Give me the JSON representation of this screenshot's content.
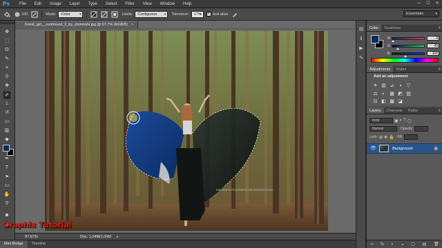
{
  "app": {
    "logo": "Ps"
  },
  "menu": {
    "items": [
      "File",
      "Edit",
      "Image",
      "Layer",
      "Type",
      "Select",
      "Filter",
      "View",
      "Window",
      "Help"
    ],
    "controls": [
      "—",
      "☐",
      "✕"
    ]
  },
  "options_bar": {
    "brush_size": "100",
    "mode_label": "Mode:",
    "mode_value": "Color",
    "limits_label": "Limits:",
    "limits_value": "Contiguous",
    "tolerance_label": "Tolerance:",
    "tolerance_value": "17%",
    "antialias_label": "Anti-alias",
    "workspace": "Essentials"
  },
  "document": {
    "tab_title": "forest_girl__continued_2_by_ztomoshi.jpg @ 97.7% (RGB/8)",
    "tab_close": "×",
    "zoom": "97.67%",
    "doc_size": "Doc: 1.04M/1.04M",
    "status_arrow": "▸",
    "image_caption": "BIELSKIPHOTOGRAPHY.DEVIANTART.COM"
  },
  "watermark": "Graphix Tutorial",
  "dock": {
    "tabs": [
      "Mini Bridge",
      "Timeline"
    ]
  },
  "color_panel": {
    "tabs": [
      "Color",
      "Swatches"
    ],
    "menu": "≡",
    "sliders": [
      {
        "letter": "R",
        "value": "4",
        "fraction": 0.016,
        "gradient": "linear-gradient(to right, #002a62, #ff2a62)"
      },
      {
        "letter": "G",
        "value": "43",
        "fraction": 0.169,
        "gradient": "linear-gradient(to right, #040062, #04ff62)"
      },
      {
        "letter": "B",
        "value": "106",
        "fraction": 0.416,
        "gradient": "linear-gradient(to right, #042a00, #042aff)"
      }
    ]
  },
  "adjustments": {
    "tabs": [
      "Adjustments",
      "Styles"
    ],
    "menu": "≡",
    "title": "Add an adjustment",
    "icons": [
      "☀",
      "▥",
      "⊿",
      "◑",
      "▽",
      "⚖",
      "◐",
      "▦",
      "◩",
      "▨",
      "⊟",
      "◧",
      "▩",
      "◪"
    ]
  },
  "layers": {
    "tabs": [
      "Layers",
      "Channels",
      "Paths"
    ],
    "menu": "≡",
    "filter_label": "Kind",
    "blend_mode": "Normal",
    "opacity_label": "Opacity:",
    "lock_label": "Lock:",
    "fill_label": "Fill:",
    "layer_name": "Background",
    "footer_icons": [
      "∞",
      "fx",
      "◐",
      "◒",
      "▢",
      "▤",
      "🗑"
    ]
  },
  "colors": {
    "foreground": "#0b2a62",
    "background": "#000000",
    "selected_layer": "#28558c",
    "watermark": "#e31d14"
  }
}
